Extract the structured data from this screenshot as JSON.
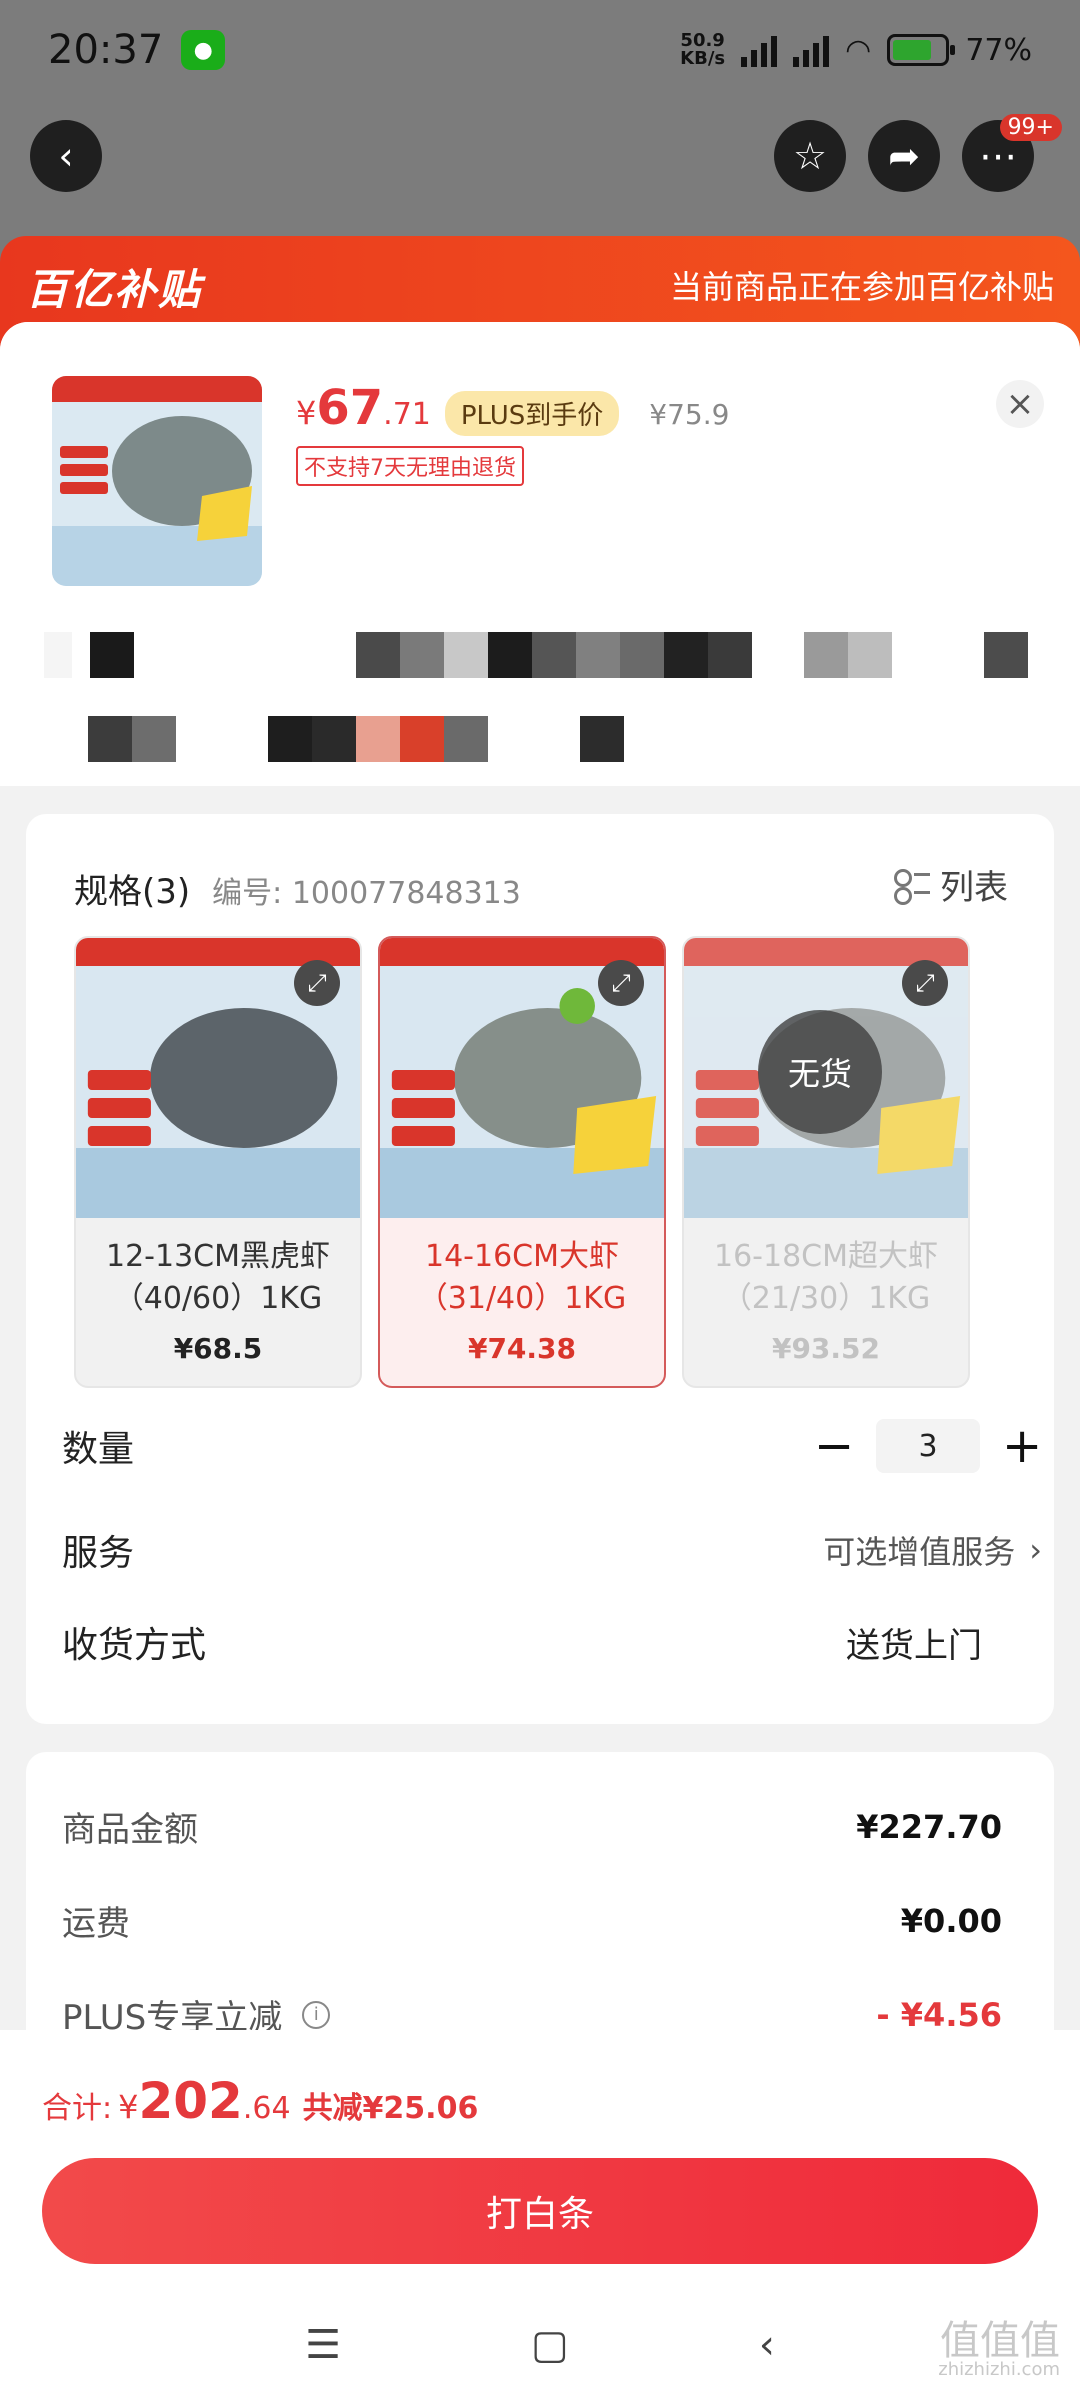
{
  "status_bar": {
    "time": "20:37",
    "net_speed": "50.9",
    "net_unit": "KB/s",
    "battery": "77%"
  },
  "nav": {
    "badge": "99+"
  },
  "banner": {
    "logo": "百亿补贴",
    "tip": "当前商品正在参加百亿补贴"
  },
  "product": {
    "price_currency": "¥",
    "price_int": "67",
    "price_dec": ".71",
    "plus_tag": "PLUS到手价",
    "original_price": "¥75.9",
    "no_return": "不支持7天无理由退货"
  },
  "spec": {
    "title": "规格(3)",
    "code": "编号: 100077848313",
    "list_label": "列表",
    "variants": [
      {
        "name": "12-13CM黑虎虾（40/60）1KG",
        "price": "¥68.5",
        "state": "normal"
      },
      {
        "name": "14-16CM大虾（31/40）1KG",
        "price": "¥74.38",
        "state": "selected"
      },
      {
        "name": "16-18CM超大虾（21/30）1KG",
        "price": "¥93.52",
        "state": "out",
        "badge": "无货"
      }
    ]
  },
  "quantity": {
    "label": "数量",
    "minus": "−",
    "value": "3",
    "plus": "+"
  },
  "service": {
    "label": "服务",
    "value": "可选增值服务"
  },
  "delivery": {
    "label": "收货方式",
    "value": "送货上门"
  },
  "summary": {
    "goods_label": "商品金额",
    "goods_value": "¥227.70",
    "shipping_label": "运费",
    "shipping_value": "¥0.00",
    "plus_label": "PLUS专享立减",
    "plus_value": "- ¥4.56"
  },
  "total": {
    "label": "合计:",
    "currency": "¥",
    "int": "202",
    "dec": ".64",
    "saved": "共减¥25.06"
  },
  "pay_button": "打白条",
  "watermark": {
    "main": "值值值",
    "sub": "zhizhizhi.com"
  },
  "colors": {
    "accent_red": "#e4393c",
    "banner_orange": "#f4561d",
    "plus_gold": "#fbe7a9"
  }
}
